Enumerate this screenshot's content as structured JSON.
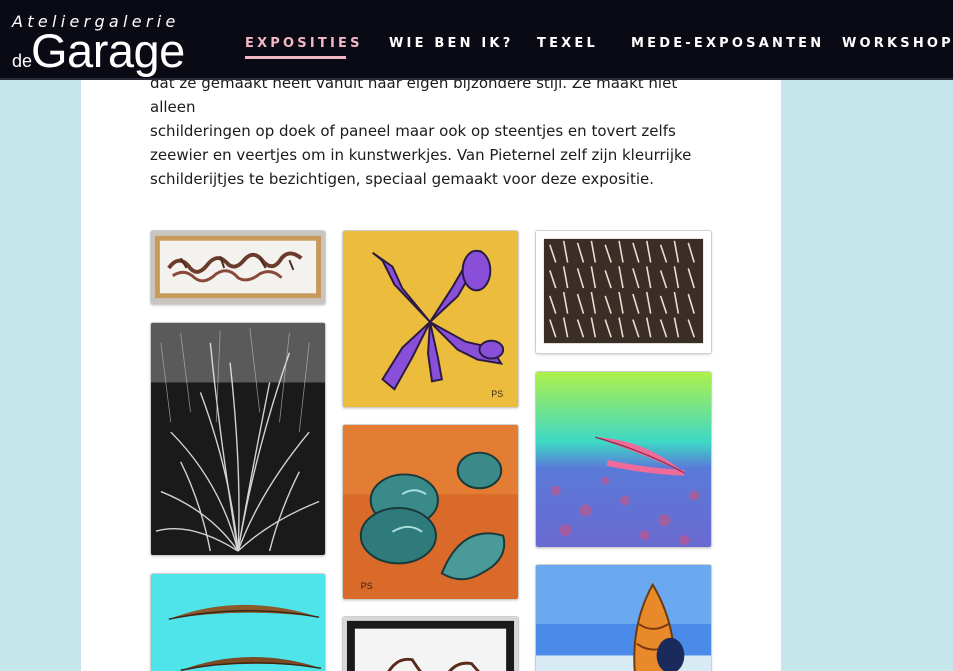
{
  "header": {
    "logo_top": "Ateliergalerie",
    "logo_de": "de",
    "logo_main": "Garage",
    "nav": [
      {
        "label": "EXPOSITIES",
        "active": true
      },
      {
        "label": "WIE BEN IK?",
        "active": false
      },
      {
        "label": "TEXEL",
        "active": false
      },
      {
        "label": "MEDE-EXPOSANTEN",
        "active": false
      },
      {
        "label": "WORKSHOPS",
        "active": false
      }
    ]
  },
  "main": {
    "intro_lines": [
      "dat ze gemaakt heeft vanuit haar eigen bijzondere stijl. Ze maakt niet alleen",
      "schilderingen op doek of paneel maar ook op steentjes en tovert zelfs",
      "zeewier en veertjes om in kunstwerkjes. Van Pieternel zelf zijn kleurrijke",
      "schilderijtjes te bezichtigen, speciaal gemaakt voor deze expositie."
    ]
  },
  "gallery": [
    {
      "name": "framed-seaweed-artwork",
      "subject": "framed seaweed"
    },
    {
      "name": "grass-photo-artwork",
      "subject": "black and white grass"
    },
    {
      "name": "feather-turquoise-artwork",
      "subject": "feathers on turquoise"
    },
    {
      "name": "purple-seaweed-painting",
      "subject": "purple seaweed on yellow"
    },
    {
      "name": "shells-painting",
      "subject": "blue shells on orange"
    },
    {
      "name": "framed-seaweed-2-artwork",
      "subject": "framed dried seaweed"
    },
    {
      "name": "feather-pattern-artwork",
      "subject": "feather pattern"
    },
    {
      "name": "pink-feather-painting",
      "subject": "pink feather"
    },
    {
      "name": "seashell-sea-painting",
      "subject": "seashell at sea"
    }
  ],
  "colors": {
    "page_background": "#c5e6eb",
    "header_background": "#0a0a14",
    "nav_active_underline": "#f2b8c6"
  }
}
